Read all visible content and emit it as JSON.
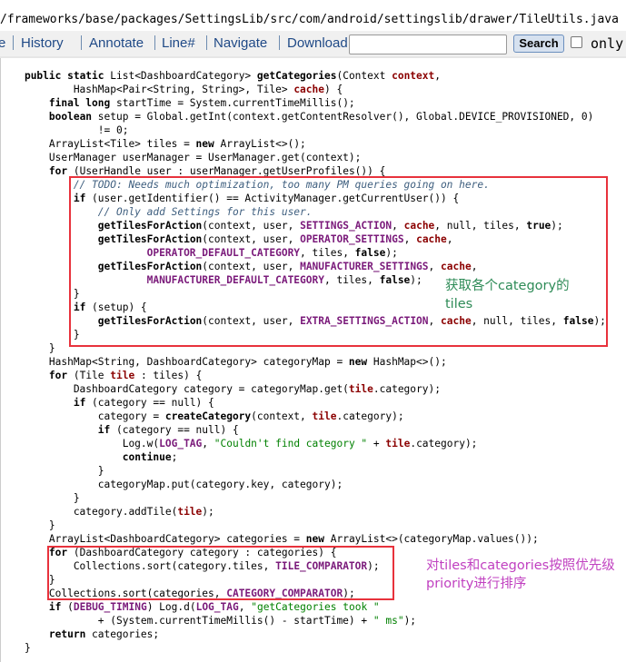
{
  "file_path": "/frameworks/base/packages/SettingsLib/src/com/android/settingslib/drawer/TileUtils.java",
  "toolbar": {
    "items": [
      "e",
      "History",
      "Annotate",
      "Line#",
      "Navigate",
      "Download"
    ],
    "search_label": "Search",
    "search_value": "",
    "only_label": "only"
  },
  "annotations": {
    "box1_text_line1": "获取各个category的",
    "box1_text_line2": "tiles",
    "box2_text_line1": "对tiles和categories按照优先级",
    "box2_text_line2": "priority进行排序",
    "box1_color": "#2e8b57",
    "box2_color": "#c040c0",
    "box_border_color": "#e8323c"
  },
  "code_lines": [
    [
      [
        "t",
        "    "
      ],
      [
        "k",
        "public static "
      ],
      [
        "t",
        "List<DashboardCategory> "
      ],
      [
        "fn",
        "getCategories"
      ],
      [
        "t",
        "(Context "
      ],
      [
        "v",
        "context"
      ],
      [
        "t",
        ","
      ]
    ],
    [
      [
        "t",
        "            HashMap<Pair<String, String>, Tile> "
      ],
      [
        "v",
        "cache"
      ],
      [
        "t",
        ") {"
      ]
    ],
    [
      [
        "t",
        "        "
      ],
      [
        "k",
        "final long "
      ],
      [
        "t",
        "startTime = System.currentTimeMillis();"
      ]
    ],
    [
      [
        "t",
        "        "
      ],
      [
        "k",
        "boolean "
      ],
      [
        "t",
        "setup = Global.getInt(context.getContentResolver(), Global.DEVICE_PROVISIONED, 0)"
      ]
    ],
    [
      [
        "t",
        "                != 0;"
      ]
    ],
    [
      [
        "t",
        "        ArrayList<Tile> tiles = "
      ],
      [
        "k",
        "new "
      ],
      [
        "t",
        "ArrayList<>();"
      ]
    ],
    [
      [
        "t",
        "        UserManager userManager = UserManager.get(context);"
      ]
    ],
    [
      [
        "t",
        "        "
      ],
      [
        "k",
        "for "
      ],
      [
        "t",
        "(UserHandle user : userManager.getUserProfiles()) {"
      ]
    ],
    [
      [
        "c",
        "            // TODO: Needs much optimization, too many PM queries going on here."
      ]
    ],
    [
      [
        "t",
        "            "
      ],
      [
        "k",
        "if "
      ],
      [
        "t",
        "(user.getIdentifier() == ActivityManager.getCurrentUser()) {"
      ]
    ],
    [
      [
        "c",
        "                // Only add Settings for this user."
      ]
    ],
    [
      [
        "t",
        "                "
      ],
      [
        "fn",
        "getTilesForAction"
      ],
      [
        "t",
        "(context, user, "
      ],
      [
        "cn",
        "SETTINGS_ACTION"
      ],
      [
        "t",
        ", "
      ],
      [
        "v",
        "cache"
      ],
      [
        "t",
        ", null, tiles, "
      ],
      [
        "k",
        "true"
      ],
      [
        "t",
        ");"
      ]
    ],
    [
      [
        "t",
        "                "
      ],
      [
        "fn",
        "getTilesForAction"
      ],
      [
        "t",
        "(context, user, "
      ],
      [
        "cn",
        "OPERATOR_SETTINGS"
      ],
      [
        "t",
        ", "
      ],
      [
        "v",
        "cache"
      ],
      [
        "t",
        ","
      ]
    ],
    [
      [
        "t",
        "                        "
      ],
      [
        "cn",
        "OPERATOR_DEFAULT_CATEGORY"
      ],
      [
        "t",
        ", tiles, "
      ],
      [
        "k",
        "false"
      ],
      [
        "t",
        ");"
      ]
    ],
    [
      [
        "t",
        "                "
      ],
      [
        "fn",
        "getTilesForAction"
      ],
      [
        "t",
        "(context, user, "
      ],
      [
        "cn",
        "MANUFACTURER_SETTINGS"
      ],
      [
        "t",
        ", "
      ],
      [
        "v",
        "cache"
      ],
      [
        "t",
        ","
      ]
    ],
    [
      [
        "t",
        "                        "
      ],
      [
        "cn",
        "MANUFACTURER_DEFAULT_CATEGORY"
      ],
      [
        "t",
        ", tiles, "
      ],
      [
        "k",
        "false"
      ],
      [
        "t",
        ");"
      ]
    ],
    [
      [
        "t",
        "            }"
      ]
    ],
    [
      [
        "t",
        "            "
      ],
      [
        "k",
        "if "
      ],
      [
        "t",
        "(setup) {"
      ]
    ],
    [
      [
        "t",
        "                "
      ],
      [
        "fn",
        "getTilesForAction"
      ],
      [
        "t",
        "(context, user, "
      ],
      [
        "cn",
        "EXTRA_SETTINGS_ACTION"
      ],
      [
        "t",
        ", "
      ],
      [
        "v",
        "cache"
      ],
      [
        "t",
        ", null, tiles, "
      ],
      [
        "k",
        "false"
      ],
      [
        "t",
        ");"
      ]
    ],
    [
      [
        "t",
        "            }"
      ]
    ],
    [
      [
        "t",
        "        }"
      ]
    ],
    [
      [
        "t",
        "        HashMap<String, DashboardCategory> categoryMap = "
      ],
      [
        "k",
        "new "
      ],
      [
        "t",
        "HashMap<>();"
      ]
    ],
    [
      [
        "t",
        "        "
      ],
      [
        "k",
        "for "
      ],
      [
        "t",
        "(Tile "
      ],
      [
        "v",
        "tile"
      ],
      [
        "t",
        " : tiles) {"
      ]
    ],
    [
      [
        "t",
        "            DashboardCategory category = categoryMap.get("
      ],
      [
        "v",
        "tile"
      ],
      [
        "t",
        ".category);"
      ]
    ],
    [
      [
        "t",
        "            "
      ],
      [
        "k",
        "if "
      ],
      [
        "t",
        "(category == null) {"
      ]
    ],
    [
      [
        "t",
        "                category = "
      ],
      [
        "fn",
        "createCategory"
      ],
      [
        "t",
        "(context, "
      ],
      [
        "v",
        "tile"
      ],
      [
        "t",
        ".category);"
      ]
    ],
    [
      [
        "t",
        "                "
      ],
      [
        "k",
        "if "
      ],
      [
        "t",
        "(category == null) {"
      ]
    ],
    [
      [
        "t",
        "                    Log.w("
      ],
      [
        "cn",
        "LOG_TAG"
      ],
      [
        "t",
        ", "
      ],
      [
        "s",
        "\"Couldn't find category \""
      ],
      [
        "t",
        " + "
      ],
      [
        "v",
        "tile"
      ],
      [
        "t",
        ".category);"
      ]
    ],
    [
      [
        "t",
        "                    "
      ],
      [
        "k",
        "continue"
      ],
      [
        "t",
        ";"
      ]
    ],
    [
      [
        "t",
        "                }"
      ]
    ],
    [
      [
        "t",
        "                categoryMap.put(category.key, category);"
      ]
    ],
    [
      [
        "t",
        "            }"
      ]
    ],
    [
      [
        "t",
        "            category.addTile("
      ],
      [
        "v",
        "tile"
      ],
      [
        "t",
        ");"
      ]
    ],
    [
      [
        "t",
        "        }"
      ]
    ],
    [
      [
        "t",
        "        ArrayList<DashboardCategory> categories = "
      ],
      [
        "k",
        "new "
      ],
      [
        "t",
        "ArrayList<>(categoryMap.values());"
      ]
    ],
    [
      [
        "t",
        "        "
      ],
      [
        "k",
        "for "
      ],
      [
        "t",
        "(DashboardCategory category : categories) {"
      ]
    ],
    [
      [
        "t",
        "            Collections.sort(category.tiles, "
      ],
      [
        "cn",
        "TILE_COMPARATOR"
      ],
      [
        "t",
        ");"
      ]
    ],
    [
      [
        "t",
        "        }"
      ]
    ],
    [
      [
        "t",
        "        Collections.sort(categories, "
      ],
      [
        "cn",
        "CATEGORY_COMPARATOR"
      ],
      [
        "t",
        ");"
      ]
    ],
    [
      [
        "t",
        "        "
      ],
      [
        "k",
        "if "
      ],
      [
        "t",
        "("
      ],
      [
        "cn",
        "DEBUG_TIMING"
      ],
      [
        "t",
        ") Log.d("
      ],
      [
        "cn",
        "LOG_TAG"
      ],
      [
        "t",
        ", "
      ],
      [
        "s",
        "\"getCategories took \""
      ]
    ],
    [
      [
        "t",
        "                + (System.currentTimeMillis() - startTime) + "
      ],
      [
        "s",
        "\" ms\""
      ],
      [
        "t",
        ");"
      ]
    ],
    [
      [
        "t",
        "        "
      ],
      [
        "k",
        "return "
      ],
      [
        "t",
        "categories;"
      ]
    ],
    [
      [
        "t",
        "    }"
      ]
    ]
  ]
}
